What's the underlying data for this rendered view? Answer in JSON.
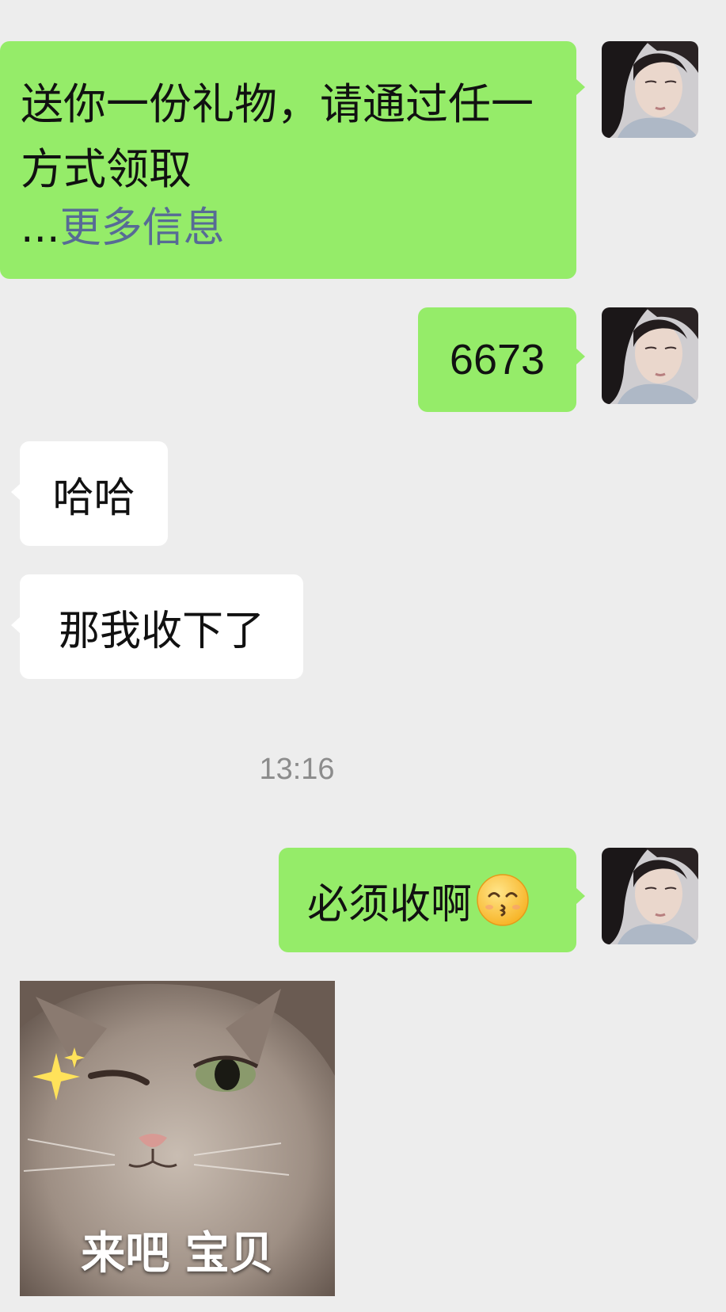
{
  "messages": [
    {
      "direction": "sent",
      "line1": "送你一份礼物，请通过任一",
      "line2": "方式领取",
      "more_prefix": "...",
      "more_link": "更多信息"
    },
    {
      "direction": "sent",
      "text": "6673"
    },
    {
      "direction": "received",
      "text": "哈哈"
    },
    {
      "direction": "received",
      "text": "那我收下了"
    },
    {
      "direction": "sent",
      "text": "必须收啊",
      "emoji": "kissing-smiling-eyes-emoji"
    },
    {
      "direction": "received",
      "sticker": "winking-cat-sticker",
      "caption": "来吧 宝贝"
    }
  ],
  "timestamp": "13:16",
  "colors": {
    "background": "#ededed",
    "sent_bubble": "#95ec69",
    "received_bubble": "#ffffff",
    "link": "#576b95",
    "timestamp_text": "#8c8c8c"
  }
}
